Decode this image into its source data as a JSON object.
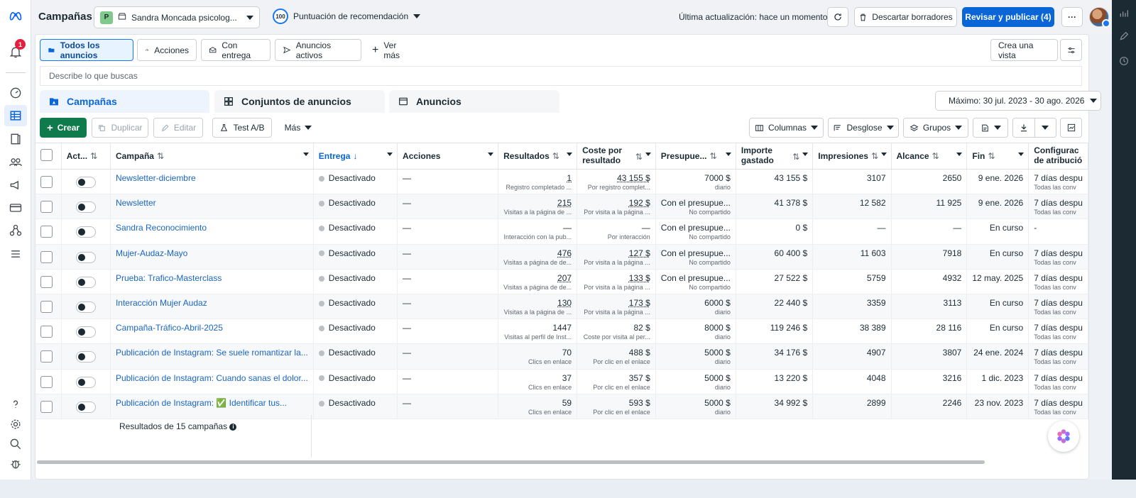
{
  "topbar": {
    "title": "Campañas",
    "account_initial": "P",
    "account_name": "Sandra Moncada psicolog...",
    "score_value": "100",
    "score_label": "Puntuación de recomendación",
    "last_update": "Última actualización: hace un momento",
    "discard_label": "Descartar borradores",
    "publish_label": "Revisar y publicar (4)",
    "more_label": "···"
  },
  "leftnav": {
    "notification_count": "1"
  },
  "views": {
    "tabs": [
      "Todos los anuncios",
      "Acciones",
      "Con entrega",
      "Anuncios activos",
      "Ver más"
    ],
    "create_view": "Crea una vista"
  },
  "search": {
    "placeholder": "Describe lo que buscas"
  },
  "level_tabs": [
    "Campañas",
    "Conjuntos de anuncios",
    "Anuncios"
  ],
  "date_range": "Máximo: 30 jul. 2023 - 30 ago. 2026",
  "toolbar": {
    "create": "Crear",
    "duplicate": "Duplicar",
    "edit": "Editar",
    "ab_test": "Test A/B",
    "more": "Más",
    "columns": "Columnas",
    "breakdown": "Desglose",
    "groups": "Grupos"
  },
  "table": {
    "headers": {
      "active": "Act...",
      "campaign": "Campaña",
      "delivery": "Entrega",
      "actions": "Acciones",
      "results": "Resultados",
      "cpr1": "Coste por",
      "cpr2": "resultado",
      "budget": "Presupue...",
      "spent1": "Importe",
      "spent2": "gastado",
      "impressions": "Impresiones",
      "reach": "Alcance",
      "end": "Fin",
      "attr1": "Configurac",
      "attr2": "de atribució"
    },
    "rows": [
      {
        "name": "Newsletter-diciembre",
        "delivery": "Desactivado",
        "actions": "—",
        "results": "1",
        "results_sub": "Registro completado ...",
        "cpr": "43 155 $",
        "cpr_sub": "Por registro complet...",
        "budget": "7000 $",
        "budget_sub": "diario",
        "spent": "43 155 $",
        "impressions": "3107",
        "reach": "2650",
        "end": "9 ene. 2026",
        "attr": "7 días despu",
        "attr_sub": "Todas las conv"
      },
      {
        "name": "Newsletter",
        "delivery": "Desactivado",
        "actions": "—",
        "results": "215",
        "results_sub": "Visitas a la página de ...",
        "cpr": "192 $",
        "cpr_sub": "Por visita a la página ...",
        "budget": "Con el presupue...",
        "budget_sub": "No compartido",
        "spent": "41 378 $",
        "impressions": "12 582",
        "reach": "11 925",
        "end": "9 ene. 2026",
        "attr": "7 días despu",
        "attr_sub": "Todas las conv"
      },
      {
        "name": "Sandra Reconocimiento",
        "delivery": "Desactivado",
        "actions": "—",
        "results": "—",
        "results_sub": "Interacción con la pub...",
        "cpr": "—",
        "cpr_sub": "Por interacción",
        "budget": "Con el presupue...",
        "budget_sub": "No compartido",
        "spent": "0 $",
        "impressions": "—",
        "reach": "—",
        "end": "En curso",
        "attr": "-",
        "attr_sub": ""
      },
      {
        "name": "Mujer-Audaz-Mayo",
        "delivery": "Desactivado",
        "actions": "—",
        "results": "476",
        "results_sub": "Visitas a página de de...",
        "cpr": "127 $",
        "cpr_sub": "Por visita a la página ...",
        "budget": "Con el presupue...",
        "budget_sub": "No compartido",
        "spent": "60 400 $",
        "impressions": "11 603",
        "reach": "7918",
        "end": "En curso",
        "attr": "7 días despu",
        "attr_sub": "Todas las conv"
      },
      {
        "name": "Prueba: Trafico-Masterclass",
        "delivery": "Desactivado",
        "actions": "—",
        "results": "207",
        "results_sub": "Visitas a página de de...",
        "cpr": "133 $",
        "cpr_sub": "Por visita a la página ...",
        "budget": "Con el presupue...",
        "budget_sub": "No compartido",
        "spent": "27 522 $",
        "impressions": "5759",
        "reach": "4932",
        "end": "12 may. 2025",
        "attr": "7 días despu",
        "attr_sub": "Todas las conv"
      },
      {
        "name": "Interacción Mujer Audaz",
        "delivery": "Desactivado",
        "actions": "—",
        "results": "130",
        "results_sub": "Visitas a la página de ...",
        "cpr": "173 $",
        "cpr_sub": "Por visita a la página ...",
        "budget": "6000 $",
        "budget_sub": "diario",
        "spent": "22 440 $",
        "impressions": "3359",
        "reach": "3113",
        "end": "En curso",
        "attr": "7 días despu",
        "attr_sub": "Todas las conv"
      },
      {
        "name": "Campaña-Tráfico-Abril-2025",
        "delivery": "Desactivado",
        "actions": "—",
        "results": "1447",
        "results_sub": "Visitas al perfil de Inst...",
        "cpr": "82 $",
        "cpr_sub": "Coste por visita al per...",
        "budget": "8000 $",
        "budget_sub": "diario",
        "spent": "119 246 $",
        "impressions": "38 389",
        "reach": "28 116",
        "end": "En curso",
        "attr": "7 días despu",
        "attr_sub": "Todas las conv"
      },
      {
        "name": "Publicación de Instagram: Se suele romantizar la...",
        "delivery": "Desactivado",
        "actions": "—",
        "results": "70",
        "results_sub": "Clics en enlace",
        "cpr": "488 $",
        "cpr_sub": "Por clic en el enlace",
        "budget": "5000 $",
        "budget_sub": "diario",
        "spent": "34 176 $",
        "impressions": "4907",
        "reach": "3807",
        "end": "24 ene. 2024",
        "attr": "7 días despu",
        "attr_sub": "Todas las conv"
      },
      {
        "name": "Publicación de Instagram: Cuando sanas el dolor...",
        "delivery": "Desactivado",
        "actions": "—",
        "results": "37",
        "results_sub": "Clics en enlace",
        "cpr": "357 $",
        "cpr_sub": "Por clic en el enlace",
        "budget": "5000 $",
        "budget_sub": "diario",
        "spent": "13 220 $",
        "impressions": "4048",
        "reach": "3216",
        "end": "1 dic. 2023",
        "attr": "7 días despu",
        "attr_sub": "Todas las conv"
      },
      {
        "name": "Publicación de Instagram: ✅ Identificar tus...",
        "delivery": "Desactivado",
        "actions": "—",
        "results": "59",
        "results_sub": "Clics en enlace",
        "cpr": "593 $",
        "cpr_sub": "Por clic en el enlace",
        "budget": "5000 $",
        "budget_sub": "diario",
        "spent": "34 992 $",
        "impressions": "2899",
        "reach": "2246",
        "end": "23 nov. 2023",
        "attr": "7 días despu",
        "attr_sub": "Todas las conv"
      }
    ],
    "footer": "Resultados de 15 campañas"
  },
  "colors": {
    "primary": "#0a66d6",
    "create_green": "#0f7b4c",
    "link": "#1a66c2",
    "badge_red": "#e41e3f"
  }
}
